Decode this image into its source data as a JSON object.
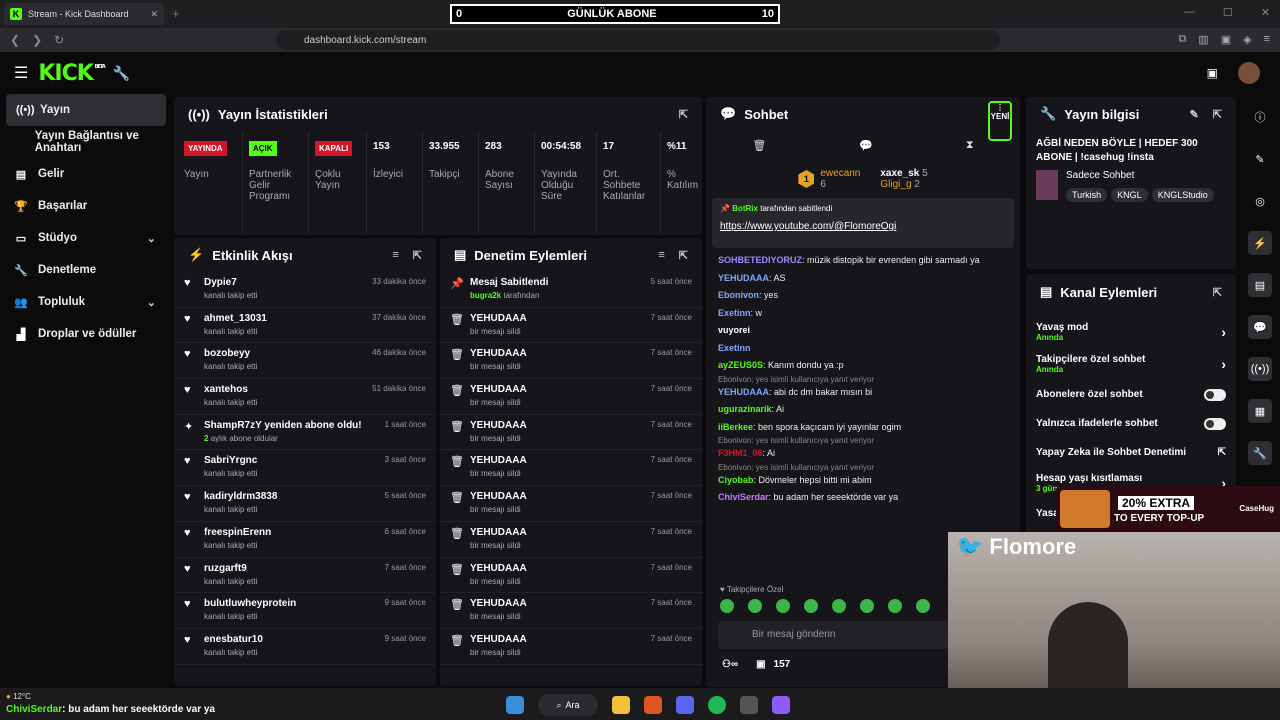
{
  "browser": {
    "tab_title": "Stream - Kick Dashboard",
    "url": "dashboard.kick.com/stream"
  },
  "sub_goal": {
    "start": "0",
    "label": "GÜNLÜK ABONE",
    "target": "10"
  },
  "header": {
    "logo": "KICK",
    "beta": "BETA"
  },
  "sidebar": {
    "items": [
      {
        "label": "Yayın",
        "icon": "broadcast-icon"
      },
      {
        "label": "Yayın Bağlantısı ve Anahtarı",
        "icon": ""
      },
      {
        "label": "Gelir",
        "icon": "revenue-icon"
      },
      {
        "label": "Başarılar",
        "icon": "trophy-icon"
      },
      {
        "label": "Stüdyo",
        "icon": "studio-icon"
      },
      {
        "label": "Denetleme",
        "icon": "moderation-icon"
      },
      {
        "label": "Topluluk",
        "icon": "community-icon"
      },
      {
        "label": "Droplar ve ödüller",
        "icon": "drops-icon"
      }
    ]
  },
  "stats": {
    "title": "Yayın İstatistikleri",
    "items": [
      {
        "value": "YAYINDA",
        "label": "Yayın"
      },
      {
        "value": "AÇIK",
        "label": "Partnerlik Gelir Programı"
      },
      {
        "value": "KAPALI",
        "label": "Çoklu Yayın"
      },
      {
        "value": "153",
        "label": "İzleyici"
      },
      {
        "value": "33.955",
        "label": "Takipçi"
      },
      {
        "value": "283",
        "label": "Abone Sayısı"
      },
      {
        "value": "00:54:58",
        "label": "Yayında Olduğu Süre"
      },
      {
        "value": "17",
        "label": "Ort. Sohbete Katılanlar"
      },
      {
        "value": "%11",
        "label": "% Katılım"
      }
    ]
  },
  "activity": {
    "title": "Etkinlik Akışı",
    "items": [
      {
        "name": "Dypie7",
        "sub": "kanalı takip etti",
        "time": "33 dakika önce",
        "icon": "heart-icon"
      },
      {
        "name": "ahmet_13031",
        "sub": "kanalı takip etti",
        "time": "37 dakika önce",
        "icon": "heart-icon"
      },
      {
        "name": "bozobeyy",
        "sub": "kanalı takip etti",
        "time": "46 dakika önce",
        "icon": "heart-icon"
      },
      {
        "name": "xantehos",
        "sub": "kanalı takip etti",
        "time": "51 dakika önce",
        "icon": "heart-icon"
      },
      {
        "name": "ShampR7zY yeniden abone oldu!",
        "sub_hl": "2",
        "sub": "aylık abone oldular",
        "time": "1 saat önce",
        "icon": "sparkle-icon"
      },
      {
        "name": "SabriYrgnc",
        "sub": "kanalı takip etti",
        "time": "3 saat önce",
        "icon": "heart-icon"
      },
      {
        "name": "kadiryldrm3838",
        "sub": "kanalı takip etti",
        "time": "5 saat önce",
        "icon": "heart-icon"
      },
      {
        "name": "freespinErenn",
        "sub": "kanalı takip etti",
        "time": "6 saat önce",
        "icon": "heart-icon"
      },
      {
        "name": "ruzgarft9",
        "sub": "kanalı takip etti",
        "time": "7 saat önce",
        "icon": "heart-icon"
      },
      {
        "name": "bulutluwheyprotein",
        "sub": "kanalı takip etti",
        "time": "9 saat önce",
        "icon": "heart-icon"
      },
      {
        "name": "enesbatur10",
        "sub": "kanalı takip etti",
        "time": "9 saat önce",
        "icon": "heart-icon"
      }
    ]
  },
  "moderation": {
    "title": "Denetim Eylemleri",
    "items": [
      {
        "name": "Mesaj Sabitlendi",
        "sub_hl": "bugra2k",
        "sub": "tarafından",
        "time": "5 saat önce",
        "icon": "pin-icon"
      },
      {
        "name": "YEHUDAAA",
        "sub": "bir mesajı sildi",
        "time": "7 saat önce",
        "icon": "trash-icon"
      },
      {
        "name": "YEHUDAAA",
        "sub": "bir mesajı sildi",
        "time": "7 saat önce",
        "icon": "trash-icon"
      },
      {
        "name": "YEHUDAAA",
        "sub": "bir mesajı sildi",
        "time": "7 saat önce",
        "icon": "trash-icon"
      },
      {
        "name": "YEHUDAAA",
        "sub": "bir mesajı sildi",
        "time": "7 saat önce",
        "icon": "trash-icon"
      },
      {
        "name": "YEHUDAAA",
        "sub": "bir mesajı sildi",
        "time": "7 saat önce",
        "icon": "trash-icon"
      },
      {
        "name": "YEHUDAAA",
        "sub": "bir mesajı sildi",
        "time": "7 saat önce",
        "icon": "trash-icon"
      },
      {
        "name": "YEHUDAAA",
        "sub": "bir mesajı sildi",
        "time": "7 saat önce",
        "icon": "trash-icon"
      },
      {
        "name": "YEHUDAAA",
        "sub": "bir mesajı sildi",
        "time": "7 saat önce",
        "icon": "trash-icon"
      },
      {
        "name": "YEHUDAAA",
        "sub": "bir mesajı sildi",
        "time": "7 saat önce",
        "icon": "trash-icon"
      },
      {
        "name": "YEHUDAAA",
        "sub": "bir mesajı sildi",
        "time": "7 saat önce",
        "icon": "trash-icon"
      }
    ]
  },
  "chat": {
    "title": "Sohbet",
    "new_label": "YENİ",
    "gifters": [
      {
        "name": "ewecann",
        "count": "6",
        "color": "#e3a423"
      },
      {
        "name": "xaxe_sk",
        "count": "5",
        "color": "#ffffff"
      },
      {
        "name": "Gligi_g",
        "count": "2",
        "color": "#e3a423"
      }
    ],
    "pinned": {
      "by": "BotRix",
      "by_suffix": "tarafından sabitlendi",
      "link": "https://www.youtube.com/@FlomoreOgi"
    },
    "messages": [
      {
        "user": "SOHBETEDIYORUZ",
        "color": "#9b8cff",
        "text": "müzik distopik bir evrenden gibi sarmadı ya"
      },
      {
        "user": "YEHUDAAA",
        "color": "#7ea8ff",
        "text": "AS"
      },
      {
        "user": "Ebonivon",
        "color": "#7ea8ff",
        "text": "yes"
      },
      {
        "user": "Exetinn",
        "color": "#7ea8ff",
        "text": "w"
      },
      {
        "user": "vuyorei",
        "color": "#ffffff",
        "text": ""
      },
      {
        "user": "Exetinn",
        "color": "#7ea8ff",
        "text": ""
      },
      {
        "user": "ayZEUS0S",
        "color": "#53fc18",
        "text": "Kanım dondu ya :p"
      },
      {
        "reply": "Ebonivon: yes isimli kullanıcıya yanıt veriyor",
        "user": "YEHUDAAA",
        "color": "#7ea8ff",
        "text": "abi dc dm bakar mısın bi"
      },
      {
        "user": "ugurazinarik",
        "color": "#53fc18",
        "text": "Ai"
      },
      {
        "user": "iiBerkee",
        "color": "#53fc18",
        "text": "ben spora kaçıcam iyi yayınlar ogim"
      },
      {
        "reply": "Ebonivon: yes isimli kullanıcıya yanıt veriyor",
        "user": "F3HM1_06",
        "color": "#d3152a",
        "text": "Ai"
      },
      {
        "reply": "Ebonivon: yes isimli kullanıcıya yanıt veriyor",
        "user": "Ciyobab",
        "color": "#53fc18",
        "text": "Dövmeler hepsi bitti mi abim"
      },
      {
        "user": "ChiviSerdar",
        "color": "#c47dff",
        "text": "bu adam her seeektörde var ya"
      }
    ],
    "followers_only": "Takipçilere Özel",
    "input_placeholder": "Bir mesaj gönderin",
    "viewer_count": "157"
  },
  "stream_info": {
    "title": "Yayın bilgisi",
    "stream_title": "AĞBİ NEDEN BÖYLE | HEDEF 300 ABONE | !casehug !insta",
    "category": "Sadece Sohbet",
    "tags": [
      "Turkish",
      "KNGL",
      "KNGLStudio"
    ]
  },
  "channel_actions": {
    "title": "Kanal Eylemleri",
    "items": [
      {
        "label": "Yavaş mod",
        "sub": "Anında",
        "control": "chevron"
      },
      {
        "label": "Takipçilere özel sohbet",
        "sub": "Anında",
        "control": "chevron"
      },
      {
        "label": "Abonelere özel sohbet",
        "sub": "",
        "control": "toggle"
      },
      {
        "label": "Yalnızca ifadelerle sohbet",
        "sub": "",
        "control": "toggle"
      },
      {
        "label": "Yapay Zeka ile Sohbet Denetimi",
        "sub": "",
        "control": "external"
      },
      {
        "label": "Hesap yaşı kısıtlaması",
        "sub": "3 gün",
        "control": "chevron"
      },
      {
        "label": "Yasal",
        "sub": "",
        "control": ""
      }
    ]
  },
  "overlay": {
    "cam_name": "Flomore",
    "ad_line1": "20% EXTRA",
    "ad_line2": "TO EVERY TOP-UP",
    "ad_brand": "CaseHug"
  },
  "taskbar": {
    "temp": "12°C",
    "ticker_user": "ChiviSerdar",
    "ticker_text": ": bu adam her seeektörde var ya",
    "search": "Ara"
  },
  "colors": {
    "accent": "#53fc18",
    "live": "#d3152a",
    "panel": "#16161a"
  }
}
